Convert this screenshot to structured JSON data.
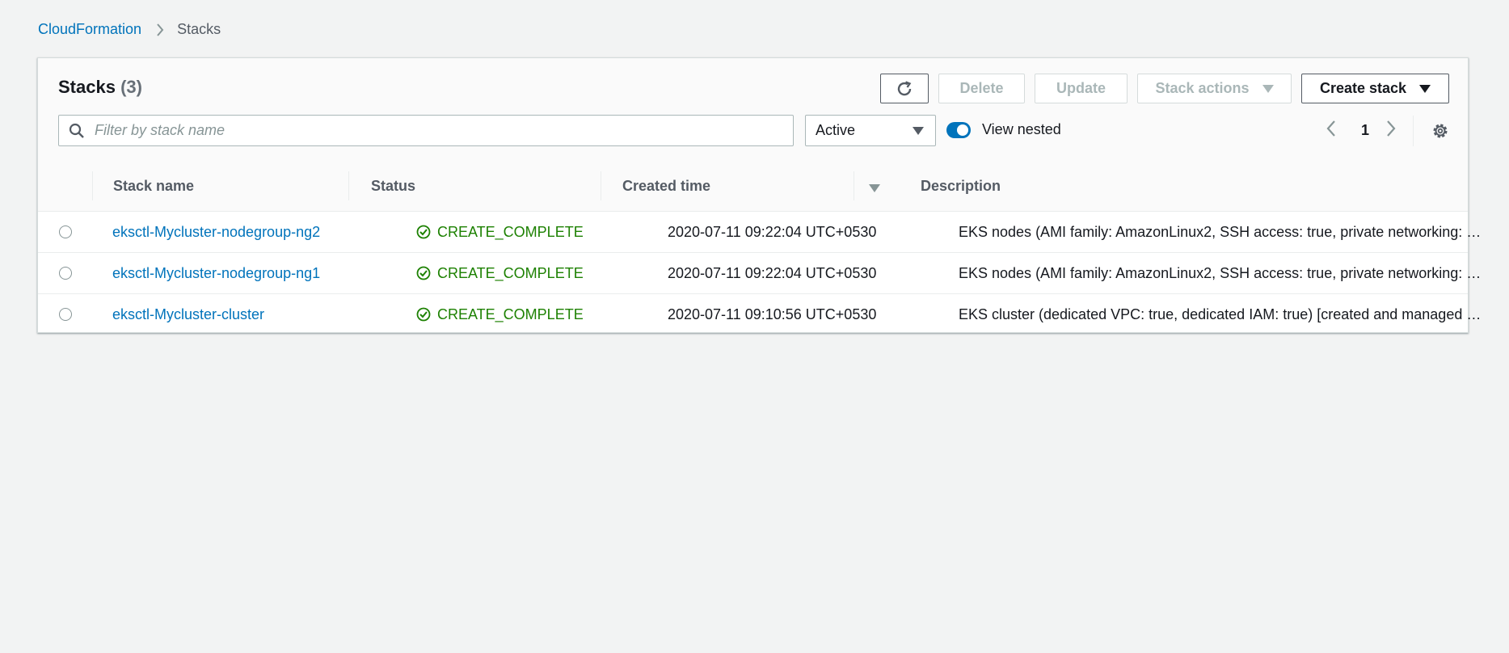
{
  "breadcrumb": {
    "root": "CloudFormation",
    "current": "Stacks"
  },
  "panel": {
    "title": "Stacks",
    "count": "(3)"
  },
  "toolbar": {
    "refresh_icon": "refresh-icon",
    "delete_label": "Delete",
    "update_label": "Update",
    "stack_actions_label": "Stack actions",
    "create_stack_label": "Create stack"
  },
  "filter": {
    "placeholder": "Filter by stack name",
    "value": "",
    "status_selected": "Active",
    "view_nested_label": "View nested",
    "view_nested_on": true
  },
  "pagination": {
    "current_page": "1"
  },
  "table": {
    "columns": [
      "Stack name",
      "Status",
      "Created time",
      "Description"
    ],
    "sort_column": "Created time",
    "sort_direction": "descending",
    "rows": [
      {
        "name": "eksctl-Mycluster-nodegroup-ng2",
        "status": "CREATE_COMPLETE",
        "created": "2020-07-11 09:22:04 UTC+0530",
        "description": "EKS nodes (AMI family: AmazonLinux2, SSH access: true, private networking: false) [created and managed by eksctl]"
      },
      {
        "name": "eksctl-Mycluster-nodegroup-ng1",
        "status": "CREATE_COMPLETE",
        "created": "2020-07-11 09:22:04 UTC+0530",
        "description": "EKS nodes (AMI family: AmazonLinux2, SSH access: true, private networking: false) [created and managed by eksctl]"
      },
      {
        "name": "eksctl-Mycluster-cluster",
        "status": "CREATE_COMPLETE",
        "created": "2020-07-11 09:10:56 UTC+0530",
        "description": "EKS cluster (dedicated VPC: true, dedicated IAM: true) [created and managed by eksctl]"
      }
    ]
  },
  "colors": {
    "link": "#0073bb",
    "success": "#1d8102",
    "background": "#f2f3f3"
  }
}
